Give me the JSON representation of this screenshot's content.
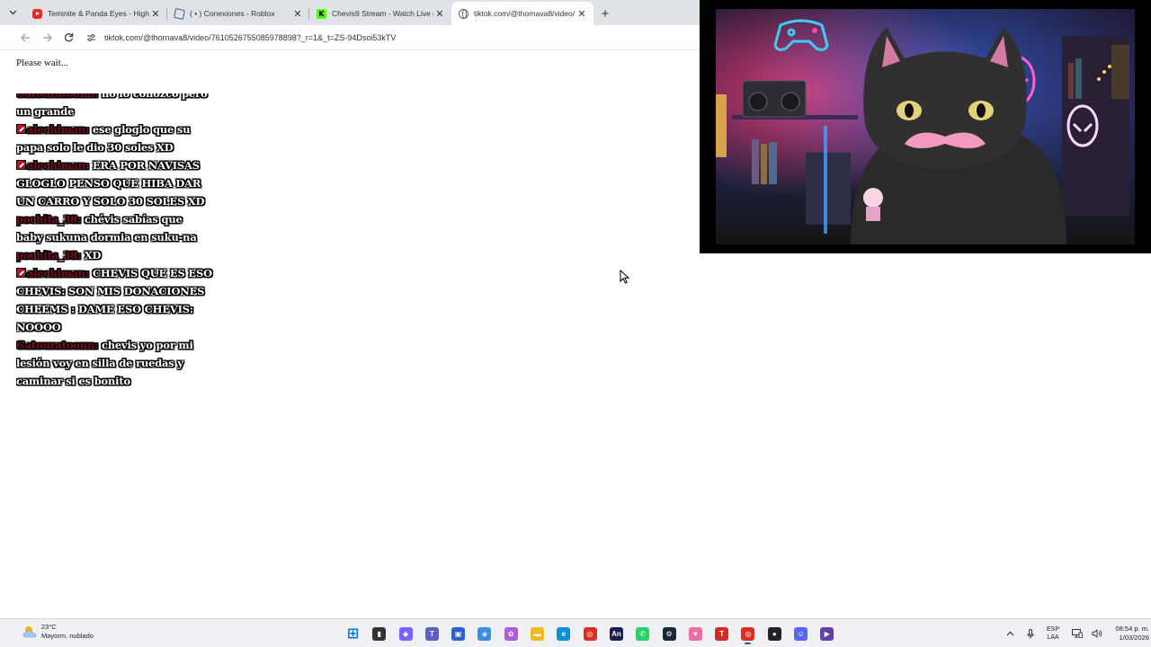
{
  "browser": {
    "tabs": [
      {
        "title": "Teminite & Panda Eyes - Highsc",
        "favicon": "youtube-icon",
        "active": false
      },
      {
        "title": "( • ) Conexiones - Roblox",
        "favicon": "roblox-icon",
        "active": false
      },
      {
        "title": "Chevis9 Stream - Watch Live on",
        "favicon": "kick-icon",
        "active": false
      },
      {
        "title": "tiktok.com/@thornava8/video/",
        "favicon": "globe-icon",
        "active": true
      }
    ],
    "url": "tiktok.com/@thornava8/video/7610526755085978898?_r=1&_t=ZS-94Dsoi53kTV"
  },
  "page": {
    "status_text": "Please wait..."
  },
  "chat": {
    "messages": [
      {
        "user": "Gatouratoonn:",
        "text": "no lo conozco pero",
        "mod": false
      },
      {
        "user": "",
        "text": "un grande",
        "mod": false
      },
      {
        "user": "alechiman:",
        "text": "ese gloglo que su",
        "mod": true
      },
      {
        "user": "",
        "text": "papa solo le dio 30 soles XD",
        "mod": false
      },
      {
        "user": "alechiman:",
        "text": "ERA POR NAVISAS",
        "mod": true
      },
      {
        "user": "",
        "text": "GLOGLO PENSO QUE HIBA DAR",
        "mod": false
      },
      {
        "user": "",
        "text": "UN CARRO Y SOLO 30 SOLES XD",
        "mod": false
      },
      {
        "user": "pochita_38:",
        "text": "chévis sabías que",
        "mod": false
      },
      {
        "user": "",
        "text": "baby sukuna dormia en suku-na",
        "mod": false
      },
      {
        "user": "pochita_38:",
        "text": "XD",
        "mod": false
      },
      {
        "user": "alechiman:",
        "text": "CHEVIS QUE ES ESO",
        "mod": true
      },
      {
        "user": "",
        "text": "CHEVIS: SON MIS DONACIONES",
        "mod": false
      },
      {
        "user": "",
        "text": "CHEEMS : DAME ESO CHEVIS:",
        "mod": false
      },
      {
        "user": "",
        "text": "NOOOO",
        "mod": false
      },
      {
        "user": "Gatouratoonn:",
        "text": "chevis yo por mi",
        "mod": false
      },
      {
        "user": "",
        "text": "lesión voy en silla de ruedas y",
        "mod": false
      },
      {
        "user": "",
        "text": "caminar si es bonito",
        "mod": false
      }
    ]
  },
  "taskbar": {
    "weather": {
      "temp": "23°C",
      "condition": "Mayorm. nublado"
    },
    "apps": [
      {
        "name": "start-icon",
        "color": "#0078d4"
      },
      {
        "name": "task-view-icon",
        "color": "#333333"
      },
      {
        "name": "copilot-icon",
        "color": "#7b61ff"
      },
      {
        "name": "teams-icon",
        "color": "#5b5fc7"
      },
      {
        "name": "store-icon",
        "color": "#2a64c9"
      },
      {
        "name": "vpn-icon",
        "color": "#3a8fe0"
      },
      {
        "name": "paint-icon",
        "color": "#b05cd6"
      },
      {
        "name": "file-explorer-icon",
        "color": "#f3b81f"
      },
      {
        "name": "edge-icon",
        "color": "#0c8fd6"
      },
      {
        "name": "chrome-icon",
        "color": "#d93025"
      },
      {
        "name": "animate-icon",
        "color": "#1b1f4d"
      },
      {
        "name": "whatsapp-icon",
        "color": "#25d366"
      },
      {
        "name": "steam-icon",
        "color": "#1b2838"
      },
      {
        "name": "vtube-icon",
        "color": "#e86fa0"
      },
      {
        "name": "text-app-icon",
        "color": "#d42a2a"
      },
      {
        "name": "chrome-active-icon",
        "color": "#d93025"
      },
      {
        "name": "recorder-icon",
        "color": "#222222"
      },
      {
        "name": "discord-icon",
        "color": "#5865f2"
      },
      {
        "name": "twitch-app-icon",
        "color": "#6441a5"
      }
    ],
    "language": [
      "ESP",
      "LAA"
    ],
    "time": "08:54 p. m.",
    "date": "1/03/2026"
  }
}
